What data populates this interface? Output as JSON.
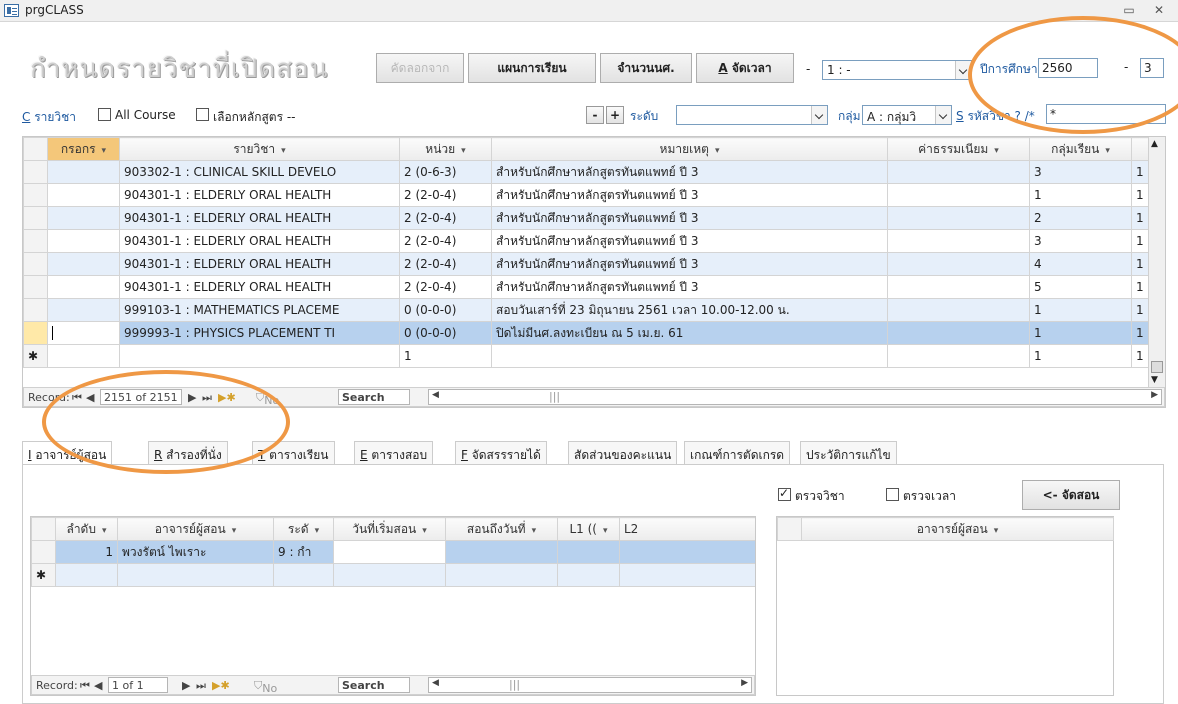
{
  "window": {
    "title": "prgCLASS",
    "minimize": "▭",
    "close": "✕"
  },
  "header": {
    "big_title": "กำหนดรายวิชาที่เปิดสอน",
    "btn_copy": "คัดลอกจาก",
    "btn_plan": "แผนการเรียน",
    "btn_count": "จำนวนนศ.",
    "btn_schedule_key": "A",
    "btn_schedule": " จัดเวลา",
    "dash1": "-",
    "semester_combo": "1 : -",
    "year_label": "ปีการศึกษา",
    "year_value": "2560",
    "dash2": "-",
    "term_value": "3"
  },
  "filter": {
    "course_key": "C",
    "course_label": " รายวิชา",
    "all_course": "All Course",
    "select_curriculum": "เลือกหลักสูตร --",
    "minus": "-",
    "plus": "+",
    "level_label": "ระดับ",
    "level_value": "",
    "group_label": "กลุ่ม",
    "group_value": "A : กลุ่มวิ",
    "code_key": "S",
    "code_label": " รหัสวิชา ? /*",
    "code_value": "*"
  },
  "main_grid": {
    "columns": [
      "กรอกร",
      "รายวิชา",
      "หน่วย",
      "หมายเหตุ",
      "ค่าธรรมเนียม",
      "กลุ่มเรียน"
    ],
    "rows": [
      {
        "course": "903302-1 : CLINICAL SKILL DEVELO",
        "unit": "2 (0-6-3)",
        "note": "สำหรับนักศึกษาหลักสูตรทันตแพทย์ ปี 3",
        "fee": "",
        "group": "3",
        "extra": "1"
      },
      {
        "course": "904301-1 : ELDERLY ORAL HEALTH",
        "unit": "2 (2-0-4)",
        "note": "สำหรับนักศึกษาหลักสูตรทันตแพทย์ ปี 3",
        "fee": "",
        "group": "1",
        "extra": "1"
      },
      {
        "course": "904301-1 : ELDERLY ORAL HEALTH",
        "unit": "2 (2-0-4)",
        "note": "สำหรับนักศึกษาหลักสูตรทันตแพทย์ ปี 3",
        "fee": "",
        "group": "2",
        "extra": "1"
      },
      {
        "course": "904301-1 : ELDERLY ORAL HEALTH",
        "unit": "2 (2-0-4)",
        "note": "สำหรับนักศึกษาหลักสูตรทันตแพทย์ ปี 3",
        "fee": "",
        "group": "3",
        "extra": "1"
      },
      {
        "course": "904301-1 : ELDERLY ORAL HEALTH",
        "unit": "2 (2-0-4)",
        "note": "สำหรับนักศึกษาหลักสูตรทันตแพทย์ ปี 3",
        "fee": "",
        "group": "4",
        "extra": "1"
      },
      {
        "course": "904301-1 : ELDERLY ORAL HEALTH",
        "unit": "2 (2-0-4)",
        "note": "สำหรับนักศึกษาหลักสูตรทันตแพทย์ ปี 3",
        "fee": "",
        "group": "5",
        "extra": "1"
      },
      {
        "course": "999103-1 : MATHEMATICS PLACEME",
        "unit": "0 (0-0-0)",
        "note": "สอบวันเสาร์ที่ 23 มิถุนายน 2561 เวลา 10.00-12.00 น.",
        "fee": "",
        "group": "1",
        "extra": "1"
      },
      {
        "course": "999993-1 : PHYSICS PLACEMENT TI",
        "unit": "0 (0-0-0)",
        "note": "ปิดไม่มีนศ.ลงทะเบียน ณ 5 เม.ย. 61",
        "fee": "",
        "group": "1",
        "extra": "1"
      }
    ],
    "new_row_marker": "✱",
    "new_row_unit": "1",
    "new_row_group": "1",
    "new_row_extra": "1"
  },
  "main_nav": {
    "record_label": "Record:",
    "position": "2151 of 2151",
    "no_filter": "No Filter",
    "search": "Search"
  },
  "tabs": [
    {
      "key": "I",
      "label": " อาจารย์ผู้สอน"
    },
    {
      "key": "R",
      "label": " สำรองที่นั่ง"
    },
    {
      "key": "T",
      "label": " ตารางเรียน"
    },
    {
      "key": "E",
      "label": " ตารางสอบ"
    },
    {
      "key": "F",
      "label": " จัดสรรรายได้"
    },
    {
      "key": "",
      "label": "สัดส่วนของคะแนน"
    },
    {
      "key": "",
      "label": "เกณฑ์การตัดเกรด"
    },
    {
      "key": "",
      "label": "ประวัติการแก้ไข"
    }
  ],
  "teacher_panel": {
    "check_course": "ตรวจวิชา",
    "check_time": "ตรวจเวลา",
    "assign_button": "<- จัดสอน",
    "columns": [
      "ลำดับ",
      "อาจารย์ผู้สอน",
      "ระดั",
      "วันที่เริ่มสอน",
      "สอนถึงวันที่",
      "L1 ((",
      "L2"
    ],
    "rows": [
      {
        "no": "1",
        "name": "พวงรัตน์  ไพเราะ",
        "level": "9 : กำ",
        "start": "",
        "end": "",
        "l1": "",
        "l2": ""
      }
    ],
    "new_row_marker": "✱",
    "right_header": "อาจารย์ผู้สอน",
    "nav": {
      "record_label": "Record:",
      "position": "1 of 1",
      "no_filter": "No Filter",
      "search": "Search"
    }
  },
  "colors": {
    "annotation": "#ef9845",
    "row_alt": "#e6effa",
    "row_selected": "#b7d1ee",
    "link_blue": "#1f5aa0"
  }
}
